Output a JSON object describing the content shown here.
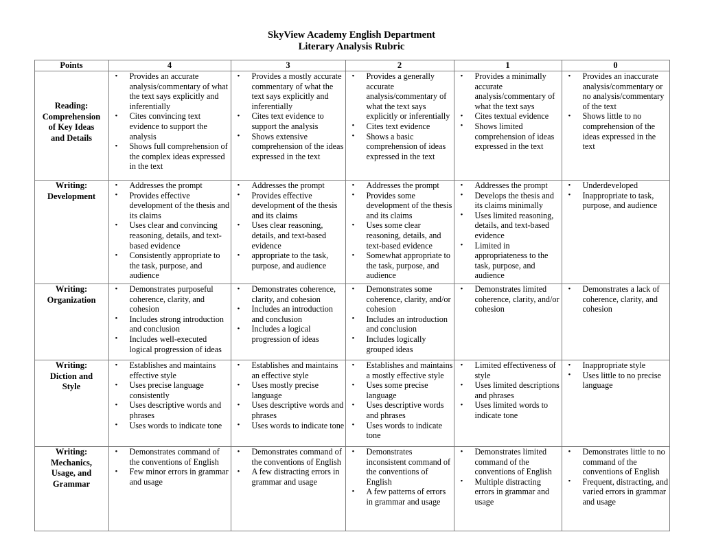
{
  "document": {
    "title_line1": "SkyView Academy English Department",
    "title_line2": "Literary Analysis Rubric"
  },
  "table": {
    "headers": [
      "Points",
      "4",
      "3",
      "2",
      "1",
      "0"
    ],
    "rows": [
      {
        "criterion": "Reading: Comprehension of Key Ideas and Details",
        "criterion_lines": [
          "Reading:",
          "Comprehension",
          "of Key Ideas",
          "and Details"
        ],
        "levels": {
          "4": [
            "Provides an accurate analysis/commentary of what the text says explicitly and inferentially",
            "Cites convincing text evidence to support the analysis",
            "Shows full comprehension of the complex ideas expressed in the text"
          ],
          "3": [
            "Provides a mostly accurate commentary of what the text says explicitly and inferentially",
            "Cites text evidence to support the analysis",
            "Shows extensive comprehension of the ideas expressed in the text"
          ],
          "2": [
            "Provides a generally accurate analysis/commentary of what the text says explicitly or inferentially",
            "Cites text evidence",
            "Shows a basic comprehension of ideas expressed in the text"
          ],
          "1": [
            "Provides a minimally accurate analysis/commentary of what the text says",
            "Cites textual evidence",
            "Shows limited comprehension of ideas expressed in the text"
          ],
          "0": [
            "Provides an inaccurate analysis/commentary or no analysis/commentary of the text",
            "Shows little to no comprehension of the ideas expressed in the text"
          ]
        }
      },
      {
        "criterion": "Writing: Development",
        "criterion_lines": [
          "Writing:",
          "Development"
        ],
        "levels": {
          "4": [
            "Addresses the prompt",
            "Provides effective development of the thesis and its claims",
            "Uses clear and convincing reasoning, details, and text-based evidence",
            "Consistently appropriate to the task, purpose, and audience"
          ],
          "3": [
            "Addresses the prompt",
            "Provides effective development of the thesis and its claims",
            "Uses clear reasoning, details, and text-based evidence",
            "appropriate to the task, purpose, and audience"
          ],
          "2": [
            "Addresses the prompt",
            "Provides some development of the thesis and its claims",
            "Uses some clear reasoning, details, and text-based evidence",
            "Somewhat appropriate to the task, purpose, and audience"
          ],
          "1": [
            "Addresses the prompt",
            "Develops the thesis and its claims minimally",
            "Uses limited reasoning, details, and text-based evidence",
            "Limited in appropriateness to the task, purpose, and audience"
          ],
          "0": [
            "Underdeveloped",
            "Inappropriate to task, purpose, and audience"
          ]
        }
      },
      {
        "criterion": "Writing: Organization",
        "criterion_lines": [
          "Writing:",
          "Organization"
        ],
        "levels": {
          "4": [
            "Demonstrates purposeful coherence, clarity, and cohesion",
            "Includes strong introduction and conclusion",
            "Includes well-executed logical progression of ideas"
          ],
          "3": [
            "Demonstrates coherence, clarity, and cohesion",
            "Includes an introduction and conclusion",
            "Includes a logical progression of ideas"
          ],
          "2": [
            "Demonstrates some coherence, clarity, and/or cohesion",
            "Includes an introduction and conclusion",
            "Includes logically grouped ideas"
          ],
          "1": [
            "Demonstrates limited coherence, clarity, and/or cohesion"
          ],
          "0": [
            "Demonstrates a lack of coherence, clarity, and cohesion"
          ]
        }
      },
      {
        "criterion": "Writing: Diction and Style",
        "criterion_lines": [
          "Writing:",
          "Diction and",
          "Style"
        ],
        "levels": {
          "4": [
            "Establishes and maintains effective style",
            "Uses precise language consistently",
            "Uses descriptive words and phrases",
            "Uses words to indicate tone"
          ],
          "3": [
            "Establishes and maintains an effective style",
            "Uses mostly precise language",
            "Uses descriptive words and phrases",
            "Uses words to indicate tone"
          ],
          "2": [
            "Establishes and maintains a mostly effective style",
            "Uses some precise language",
            "Uses descriptive words and phrases",
            "Uses words to indicate tone"
          ],
          "1": [
            "Limited effectiveness of style",
            "Uses limited descriptions and phrases",
            "Uses limited words to indicate tone"
          ],
          "0": [
            "Inappropriate style",
            "Uses little to no precise language"
          ]
        }
      },
      {
        "criterion": "Writing: Mechanics, Usage, and Grammar",
        "criterion_lines": [
          "Writing:",
          "Mechanics,",
          "Usage, and",
          "Grammar"
        ],
        "levels": {
          "4": [
            "Demonstrates command of the conventions of English",
            "Few minor errors in grammar and usage"
          ],
          "3": [
            "Demonstrates command of the conventions of English",
            "A few distracting errors in grammar and usage"
          ],
          "2": [
            "Demonstrates inconsistent command of the conventions of English",
            "A few patterns of errors in grammar and usage"
          ],
          "1": [
            "Demonstrates limited command of the conventions of English",
            "Multiple distracting errors in grammar and usage"
          ],
          "0": [
            "Demonstrates little to no command of the conventions of English",
            "Frequent, distracting, and varied errors in grammar and usage"
          ]
        }
      }
    ]
  }
}
